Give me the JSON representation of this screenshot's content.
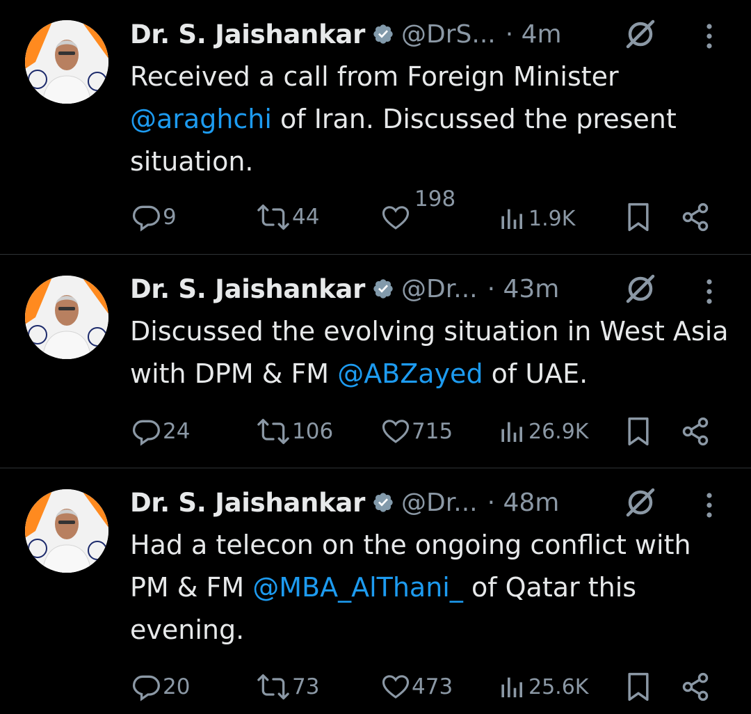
{
  "tweets": [
    {
      "name": "Dr. S. Jaishankar",
      "handle": "@DrS...",
      "time": "· 4m",
      "text_before": "Received a call from Foreign Minister ",
      "mention": "@araghchi",
      "text_after": " of Iran. Discussed the present situation.",
      "replies": "9",
      "reposts": "44",
      "likes": "198",
      "views": "1.9K"
    },
    {
      "name": "Dr. S. Jaishankar",
      "handle": "@Dr...",
      "time": "· 43m",
      "text_before": "Discussed the evolving situation in West Asia with DPM & FM ",
      "mention": "@ABZayed",
      "text_after": " of UAE.",
      "replies": "24",
      "reposts": "106",
      "likes": "715",
      "views": "26.9K"
    },
    {
      "name": "Dr. S. Jaishankar",
      "handle": "@Dr...",
      "time": "· 48m",
      "text_before": "Had a telecon on the ongoing conflict with PM & FM ",
      "mention": "@MBA_AlThani_",
      "text_after": " of Qatar this evening.",
      "replies": "20",
      "reposts": "73",
      "likes": "473",
      "views": "25.6K"
    }
  ],
  "icons": {
    "reply": "reply-icon",
    "repost": "repost-icon",
    "like": "heart-icon",
    "views": "views-icon",
    "bookmark": "bookmark-icon",
    "share": "share-icon",
    "verified": "verified-badge-icon",
    "grok": "grok-icon",
    "more": "more-icon"
  },
  "colors": {
    "background": "#000000",
    "text": "#e7e9ea",
    "secondary": "#8b98a5",
    "link": "#1d9bf0",
    "divider": "#2f3336"
  }
}
